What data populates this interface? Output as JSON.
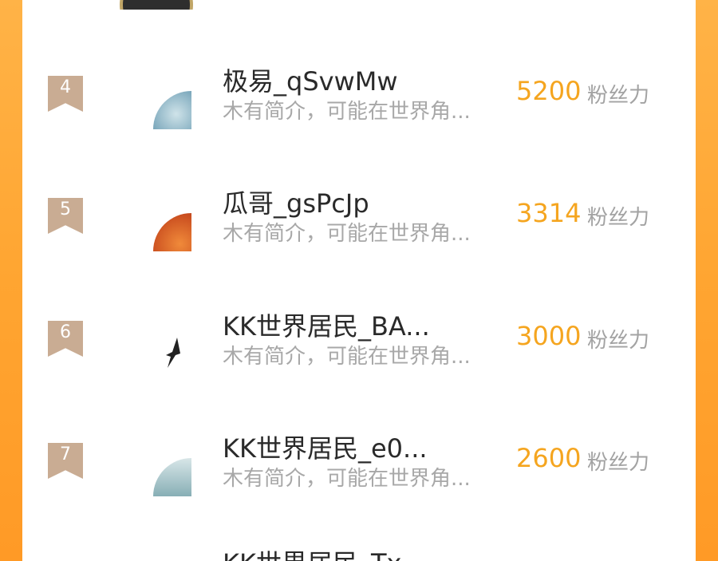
{
  "rows": [
    {
      "rank": "4",
      "name": "极易_qSvwMw",
      "bio": "木有简介，可能在世界角...",
      "score": "5200",
      "unit": "粉丝力",
      "avatar_color": "#7a9bb0"
    },
    {
      "rank": "5",
      "name": "瓜哥_gsPcJp",
      "bio": "木有简介，可能在世界角...",
      "score": "3314",
      "unit": "粉丝力",
      "avatar_color": "#d4602a"
    },
    {
      "rank": "6",
      "name": "KK世界居民_BA...",
      "bio": "木有简介，可能在世界角...",
      "score": "3000",
      "unit": "粉丝力",
      "avatar_color": "#ffffff"
    },
    {
      "rank": "7",
      "name": "KK世界居民_e0...",
      "bio": "木有简介，可能在世界角...",
      "score": "2600",
      "unit": "粉丝力",
      "avatar_color": "#8fb3b8"
    }
  ],
  "cut_row": {
    "name": "KK世界居民_Tx"
  },
  "colors": {
    "accent": "#f5a51f",
    "rank_badge": "#c9ac93",
    "background": "#ffa531"
  }
}
